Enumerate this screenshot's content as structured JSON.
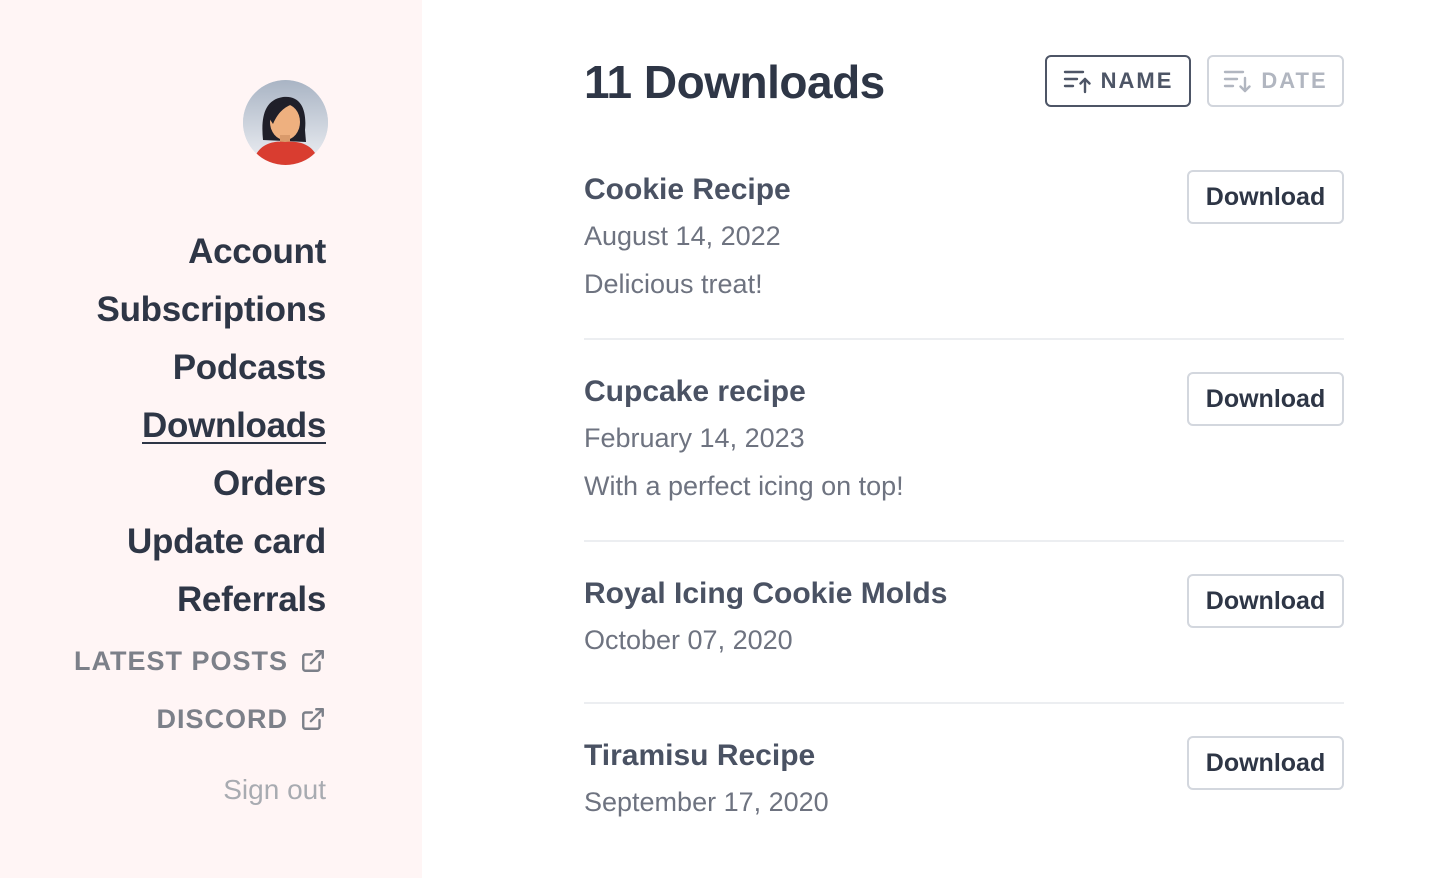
{
  "sidebar": {
    "nav": [
      {
        "label": "Account"
      },
      {
        "label": "Subscriptions"
      },
      {
        "label": "Podcasts"
      },
      {
        "label": "Downloads",
        "active": true
      },
      {
        "label": "Orders"
      },
      {
        "label": "Update card"
      },
      {
        "label": "Referrals"
      }
    ],
    "external": [
      {
        "label": "LATEST POSTS",
        "icon": "external-link-icon"
      },
      {
        "label": "DISCORD",
        "icon": "external-link-icon"
      }
    ],
    "sign_out": "Sign out"
  },
  "main": {
    "title": "11 Downloads",
    "sort": {
      "name_label": "NAME",
      "date_label": "DATE",
      "active": "name"
    },
    "downloads": [
      {
        "title": "Cookie Recipe",
        "date": "August 14, 2022",
        "description": "Delicious treat!",
        "button": "Download"
      },
      {
        "title": "Cupcake recipe",
        "date": "February 14, 2023",
        "description": "With a perfect icing on top!",
        "button": "Download"
      },
      {
        "title": "Royal Icing Cookie Molds",
        "date": "October 07, 2020",
        "description": "",
        "button": "Download"
      },
      {
        "title": "Tiramisu Recipe",
        "date": "September 17, 2020",
        "description": "",
        "button": "Download"
      }
    ]
  },
  "colors": {
    "sidebar_bg": "#fff5f5",
    "text_dark": "#2e3646",
    "text_muted": "#6e7380",
    "avatar_shirt": "#d93d30"
  }
}
